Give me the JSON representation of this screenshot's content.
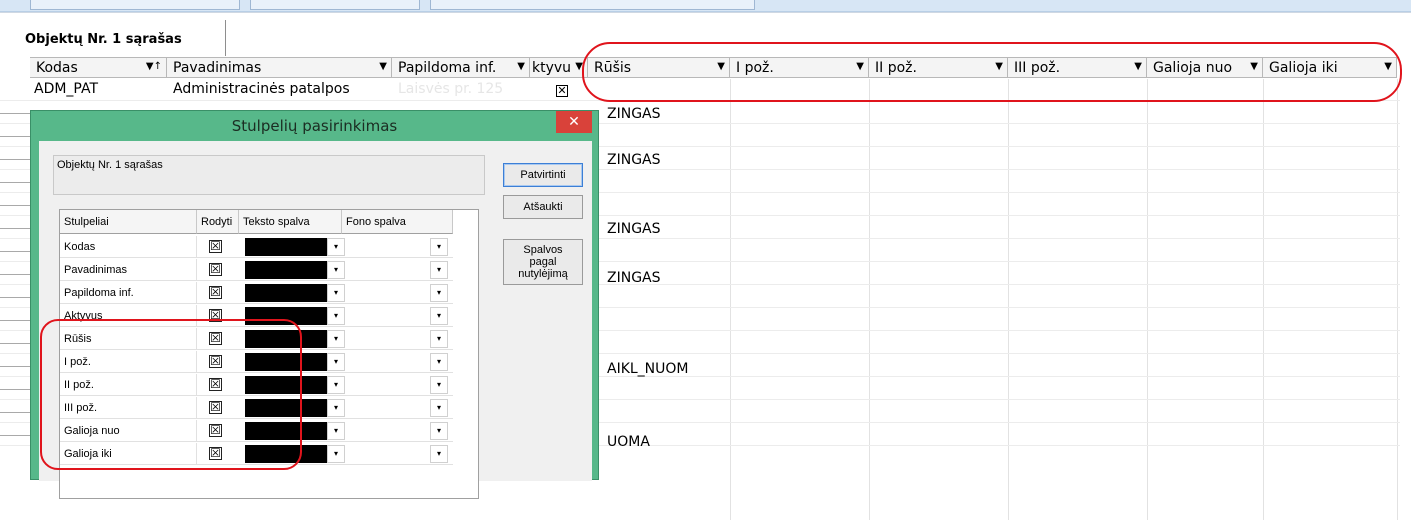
{
  "list_title": "Objektų Nr. 1 sąrašas",
  "grid": {
    "columns": [
      {
        "label": "Kodas",
        "arrow": "▼↑"
      },
      {
        "label": "Pavadinimas",
        "arrow": "▼"
      },
      {
        "label": "Papildoma inf.",
        "arrow": "▼"
      },
      {
        "label": "ktyvu",
        "arrow": "▼"
      },
      {
        "label": "Rūšis",
        "arrow": "▼"
      },
      {
        "label": "I pož.",
        "arrow": "▼"
      },
      {
        "label": "II pož.",
        "arrow": "▼"
      },
      {
        "label": "III pož.",
        "arrow": "▼"
      },
      {
        "label": "Galioja nuo",
        "arrow": "▼"
      },
      {
        "label": "Galioja iki",
        "arrow": "▼"
      }
    ],
    "first_row": {
      "kodas": "ADM_PAT",
      "pavadinimas": "Administracinės patalpos",
      "papildoma": "Laisvės pr. 125",
      "aktyvus_mark": "✕"
    },
    "rusis_values": [
      "ZINGAS",
      "ZINGAS",
      "ZINGAS",
      "ZINGAS",
      "AIKL_NUOM",
      "UOMA"
    ]
  },
  "dialog": {
    "title": "Stulpelių pasirinkimas",
    "close": "✕",
    "group_text": "Objektų Nr. 1 sąrašas",
    "buttons": {
      "confirm": "Patvirtinti",
      "cancel": "Atšaukti",
      "default_colors": [
        "Spalvos",
        "pagal",
        "nutylėjimą"
      ]
    },
    "table": {
      "headers": [
        "Stulpeliai",
        "Rodyti",
        "Teksto spalva",
        "Fono spalva"
      ],
      "rows": [
        {
          "name": "Kodas",
          "shown": "☒"
        },
        {
          "name": "Pavadinimas",
          "shown": "☒"
        },
        {
          "name": "Papildoma inf.",
          "shown": "☒"
        },
        {
          "name": "Aktyvus",
          "shown": "☒"
        },
        {
          "name": "Rūšis",
          "shown": "☒"
        },
        {
          "name": "I pož.",
          "shown": "☒"
        },
        {
          "name": "II pož.",
          "shown": "☒"
        },
        {
          "name": "III pož.",
          "shown": "☒"
        },
        {
          "name": "Galioja nuo",
          "shown": "☒"
        },
        {
          "name": "Galioja iki",
          "shown": "☒"
        }
      ],
      "dropdown_glyph": "▾"
    }
  },
  "colors": {
    "dialog_frame": "#57b88a",
    "highlight": "#e0141c",
    "text_color_swatch": "#000000"
  }
}
